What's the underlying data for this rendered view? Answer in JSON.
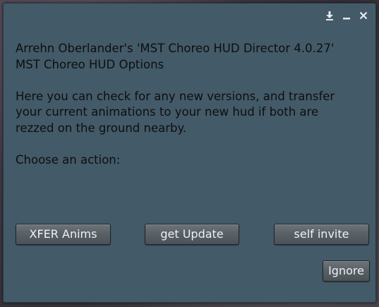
{
  "window": {
    "controls": [
      {
        "name": "dock-icon"
      },
      {
        "name": "minimize-icon"
      },
      {
        "name": "close-icon"
      }
    ]
  },
  "message": {
    "header": "Arrehn Oberlander's 'MST Choreo HUD Director 4.0.27'\nMST Choreo HUD Options",
    "body": "Here you can check for any new versions, and transfer\nyour current animations to your new hud if both are\nrezzed on the ground nearby.",
    "prompt": "Choose an action:"
  },
  "buttons": {
    "xfer": "XFER Anims",
    "update": "get Update",
    "invite": "self invite",
    "ignore": "Ignore"
  },
  "colors": {
    "dialog_background": "#435a68",
    "text": "#0d0f10",
    "button_text": "#eef1f3"
  }
}
